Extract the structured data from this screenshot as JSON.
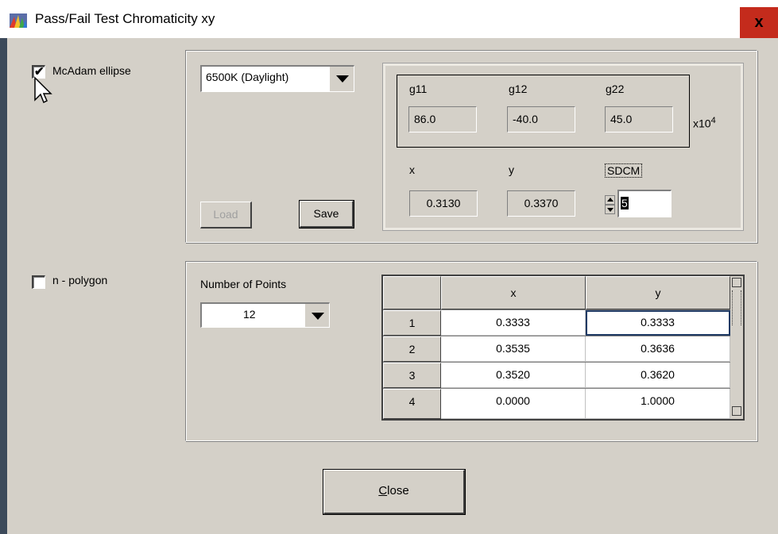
{
  "window": {
    "title": "Pass/Fail Test Chromaticity xy",
    "close_glyph": "x"
  },
  "ellipse": {
    "checkbox_label": "McAdam ellipse",
    "checked": true,
    "illuminant_select": "6500K (Daylight)",
    "load_label": "Load",
    "save_label": "Save",
    "g11_label": "g11",
    "g12_label": "g12",
    "g22_label": "g22",
    "g11": "86.0",
    "g12": "-40.0",
    "g22": "45.0",
    "scale_prefix": "x10",
    "scale_exp": "4",
    "x_label": "x",
    "y_label": "y",
    "sdcm_label": "SDCM",
    "x": "0.3130",
    "y": "0.3370",
    "sdcm": "5"
  },
  "polygon": {
    "checkbox_label": "n - polygon",
    "checked": false,
    "points_label": "Number of Points",
    "points_value": "12",
    "table": {
      "headers": [
        "",
        "x",
        "y"
      ],
      "rows": [
        {
          "n": "1",
          "x": "0.3333",
          "y": "0.3333"
        },
        {
          "n": "2",
          "x": "0.3535",
          "y": "0.3636"
        },
        {
          "n": "3",
          "x": "0.3520",
          "y": "0.3620"
        },
        {
          "n": "4",
          "x": "0.0000",
          "y": "1.0000"
        }
      ]
    }
  },
  "close_button": "Close",
  "colors": {
    "titlebar": "#ffffff",
    "close_bg": "#c42b1c",
    "dialog_bg": "#d4d0c8"
  }
}
